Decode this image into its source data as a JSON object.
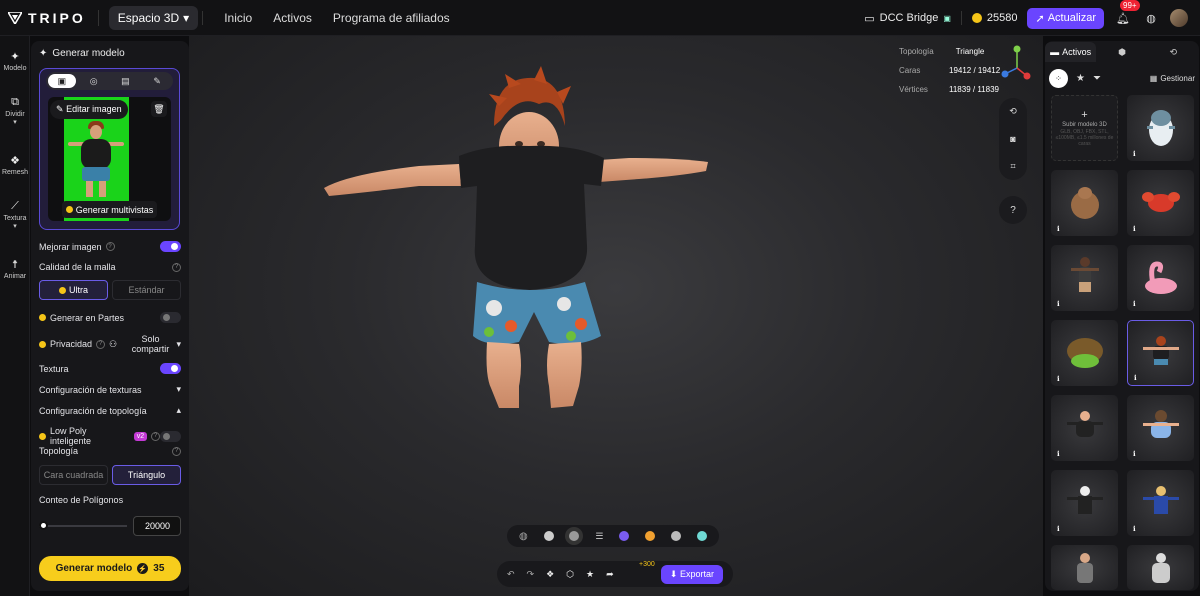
{
  "app": {
    "brand": "TRIPO",
    "space": "Espacio 3D"
  },
  "nav": [
    "Inicio",
    "Activos",
    "Programa de afiliados"
  ],
  "header": {
    "dcc": "DCC Bridge",
    "credits": "25580",
    "upgrade": "Actualizar",
    "badge": "99+"
  },
  "left_nav": [
    {
      "label": "Modelo",
      "icon": "sparkle-icon"
    },
    {
      "label": "Dividir",
      "icon": "split-icon"
    },
    {
      "label": "Remesh",
      "icon": "remesh-icon"
    },
    {
      "label": "Textura",
      "icon": "texture-icon"
    },
    {
      "label": "Animar",
      "icon": "animate-icon"
    }
  ],
  "panel": {
    "title": "Generar modelo",
    "edit_image": "Editar imagen",
    "generate_multiview": "Generar multivistas",
    "mejorar_imagen": "Mejorar imagen",
    "calidad_malla": "Calidad de la malla",
    "quality_options": [
      "Ultra",
      "Estándar"
    ],
    "generar_partes": "Generar en Partes",
    "privacidad": "Privacidad",
    "privacy_value": "Solo compartir",
    "textura": "Textura",
    "config_texturas": "Configuración de texturas",
    "config_topologia": "Configuración de topología",
    "low_poly": "Low Poly inteligente",
    "v2": "v2",
    "topologia": "Topología",
    "topology_options": [
      "Cara cuadrada",
      "Triángulo"
    ],
    "conteo": "Conteo de Polígonos",
    "poly_count": "20000",
    "poly_count_fraction": 0,
    "generate_button": "Generar modelo",
    "generate_cost": "35",
    "toggles": {
      "mejorar_imagen": true,
      "generar_partes": false,
      "textura": true,
      "low_poly": false
    }
  },
  "stats": {
    "topologia_label": "Topología",
    "topologia_value": "Triangle",
    "caras_label": "Caras",
    "caras_value": "19412 / 19412",
    "vertices_label": "Vértices",
    "vertices_value": "11839 / 11839"
  },
  "viewport_tools": {
    "help": "?",
    "export": "Exportar",
    "bonus": "+300"
  },
  "colors": {
    "accent": "#6a45ff",
    "generate": "#f7cd1c",
    "upgrade": "#6a45ff"
  },
  "right_panel": {
    "tab_assets": "Activos",
    "manage": "Gestionar",
    "upload_title": "Subir modelo 3D",
    "upload_hint": "GLB, OBJ, FBX, STL, ≤100MB, ≤1.5 millones de caras"
  }
}
